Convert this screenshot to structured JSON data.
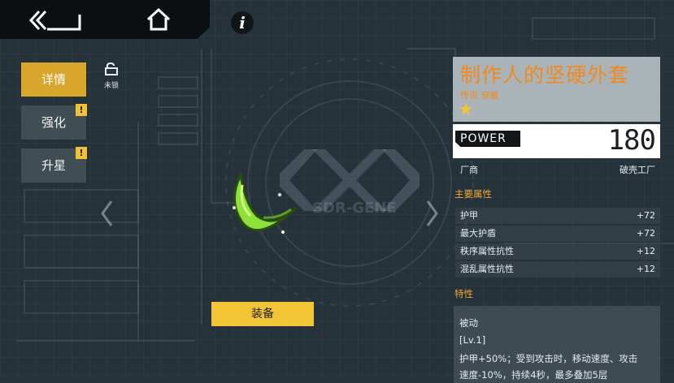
{
  "nav": {
    "back_icon": "back-arrow-icon",
    "home_icon": "home-icon",
    "info_label": "i"
  },
  "tabs": [
    {
      "label": "详情",
      "active": true
    },
    {
      "label": "强化",
      "alert": "!"
    },
    {
      "label": "升星",
      "alert": "!"
    }
  ],
  "lock": {
    "icon": "lock-icon",
    "label": "未锁"
  },
  "background_text": {
    "logo": "SDR-GENE"
  },
  "item": {
    "name": "制作人的坚硬外套",
    "tags": "传说 穿戴",
    "stars": 1,
    "icon": "green-crescent-badge-icon",
    "power_label": "POWER",
    "power_value": "180",
    "manufacturer_label": "厂商",
    "manufacturer_value": "破壳工厂"
  },
  "main_attrs": {
    "title": "主要属性",
    "rows": [
      {
        "label": "护甲",
        "value": "+72"
      },
      {
        "label": "最大护盾",
        "value": "+72"
      },
      {
        "label": "秩序属性抗性",
        "value": "+12"
      },
      {
        "label": "混乱属性抗性",
        "value": "+12"
      }
    ]
  },
  "traits": {
    "title": "特性",
    "type": "被动",
    "level": "[Lv.1]",
    "line1": "护甲+50%；受到攻击时，移动速度、攻击",
    "line2": "速度-10%，持续4秒，最多叠加5层"
  },
  "equip_button": {
    "label": "装备"
  },
  "colors": {
    "accent_gold": "#d8a62a",
    "button_yellow": "#f2c536",
    "name_orange": "#f08a1c",
    "item_green": "#8ee03a"
  }
}
